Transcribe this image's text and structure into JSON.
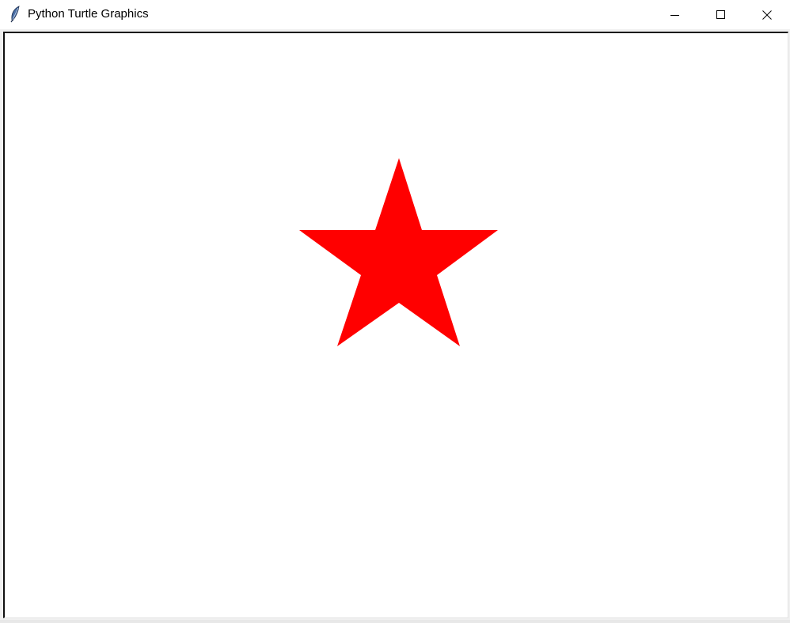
{
  "window": {
    "title": "Python Turtle Graphics",
    "icon": "feather-icon",
    "controls": {
      "minimize_icon": "minimize-icon",
      "maximize_icon": "maximize-icon",
      "close_icon": "close-icon"
    }
  },
  "canvas": {
    "background_color": "#ffffff",
    "shapes": [
      {
        "type": "star",
        "points": 5,
        "fill_color": "#ff0000"
      }
    ]
  }
}
